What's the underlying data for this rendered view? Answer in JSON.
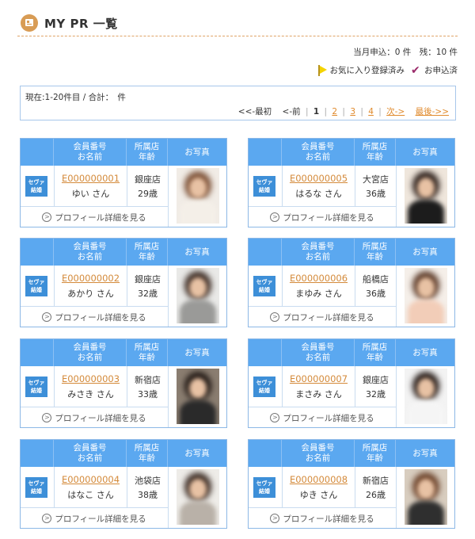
{
  "header": {
    "title": "MY PR 一覧",
    "icon": "document-icon"
  },
  "status": {
    "text": "当月申込：0 件　残：10 件"
  },
  "legend": {
    "favorite_label": "お気に入り登録済み",
    "applied_label": "お申込済"
  },
  "pager": {
    "current": "現在:1-20件目 / 合計：　件",
    "first": "<<-最初",
    "prev": "<-前",
    "pages": [
      "1",
      "2",
      "3",
      "4"
    ],
    "next": "次->",
    "last": "最後->>"
  },
  "card_headers": {
    "id_label": "会員番号",
    "name_label": "お名前",
    "store_label": "所属店",
    "age_label": "年齢",
    "photo_label": "お写真"
  },
  "detail_label": "プロフィール詳細を見る",
  "logo_text": [
    "セヴァ",
    "結婚"
  ],
  "members": [
    {
      "id": "E000000001",
      "name": "ゆい さん",
      "store": "銀座店",
      "age": "29歳",
      "hair": "#7a4e33",
      "top": "#f4efe8",
      "bg": "#f1ece6"
    },
    {
      "id": "E000000005",
      "name": "はるな さん",
      "store": "大宮店",
      "age": "36歳",
      "hair": "#2a1d18",
      "top": "#1c1c1c",
      "bg": "#efe6dc"
    },
    {
      "id": "E000000002",
      "name": "あかり さん",
      "store": "銀座店",
      "age": "32歳",
      "hair": "#3b2a22",
      "top": "#9a9a98",
      "bg": "#e9e9e7"
    },
    {
      "id": "E000000006",
      "name": "まゆみ さん",
      "store": "船橋店",
      "age": "36歳",
      "hair": "#5c3a28",
      "top": "#f2cdb8",
      "bg": "#f5efe9"
    },
    {
      "id": "E000000003",
      "name": "みさき さん",
      "store": "新宿店",
      "age": "33歳",
      "hair": "#1e1612",
      "top": "#2a2a2a",
      "bg": "#8a7d70"
    },
    {
      "id": "E000000007",
      "name": "まさみ さん",
      "store": "銀座店",
      "age": "32歳",
      "hair": "#241915",
      "top": "#f5f5f5",
      "bg": "#f3f3f3"
    },
    {
      "id": "E000000004",
      "name": "はなこ さん",
      "store": "池袋店",
      "age": "38歳",
      "hair": "#3a2a22",
      "top": "#b9b1a8",
      "bg": "#eeece8"
    },
    {
      "id": "E000000008",
      "name": "ゆき さん",
      "store": "新宿店",
      "age": "26歳",
      "hair": "#6a4028",
      "top": "#2f2f2f",
      "bg": "#d8cdbf"
    }
  ]
}
